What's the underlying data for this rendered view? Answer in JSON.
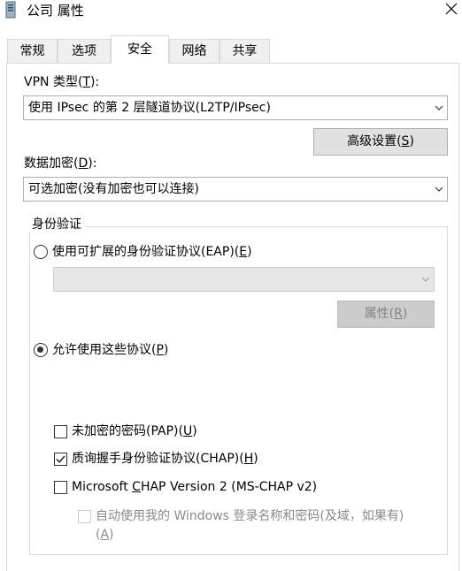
{
  "window": {
    "title": "公司 属性"
  },
  "tabs": [
    {
      "label": "常规"
    },
    {
      "label": "选项"
    },
    {
      "label": "安全"
    },
    {
      "label": "网络"
    },
    {
      "label": "共享"
    }
  ],
  "active_tab": "安全",
  "vpn_type": {
    "label_prefix": "VPN 类型(",
    "label_key": "T",
    "label_suffix": "):",
    "selected": "使用 IPsec 的第 2 层隧道协议(L2TP/IPsec)"
  },
  "advanced_button": {
    "prefix": "高级设置(",
    "key": "S",
    "suffix": ")"
  },
  "encryption": {
    "label_prefix": "数据加密(",
    "label_key": "D",
    "label_suffix": "):",
    "selected": "可选加密(没有加密也可以连接)"
  },
  "auth": {
    "group_title": "身份验证",
    "eap_radio": {
      "prefix": "使用可扩展的身份验证协议(EAP)(",
      "key": "E",
      "suffix": ")",
      "checked": false
    },
    "eap_combo_value": "",
    "properties_button": {
      "prefix": "属性(",
      "key": "R",
      "suffix": ")",
      "enabled": false
    },
    "allow_radio": {
      "prefix": "允许使用这些协议(",
      "key": "P",
      "suffix": ")",
      "checked": true
    },
    "protocols": [
      {
        "prefix": "未加密的密码(PAP)(",
        "key": "U",
        "suffix": ")",
        "checked": false
      },
      {
        "prefix": "质询握手身份验证协议(CHAP)(",
        "key": "H",
        "suffix": ")",
        "checked": true
      },
      {
        "prefix": "Microsoft ",
        "key": "C",
        "suffix": "HAP Version 2 (MS-CHAP v2)",
        "checked": false
      }
    ],
    "auto_logon": {
      "line1": "自动使用我的 Windows 登录名称和密码(及域，如果有)",
      "line2_prefix": "(",
      "key": "A",
      "line2_suffix": ")",
      "checked": false,
      "enabled": false
    }
  },
  "colors": {
    "border": "#d9d9d9",
    "button_bg": "#e1e1e1",
    "disabled_bg": "#cccccc"
  }
}
